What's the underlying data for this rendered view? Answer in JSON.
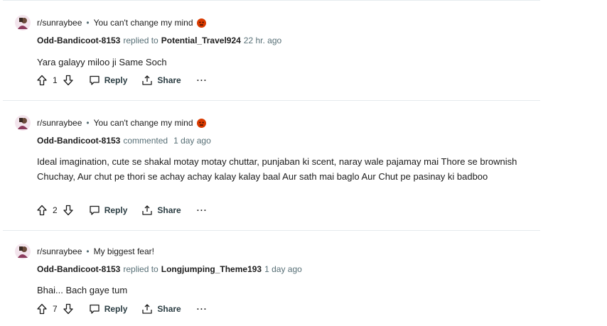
{
  "comments": [
    {
      "subreddit": "r/sunraybee",
      "separator": "•",
      "post_title": "You can't change my mind",
      "has_emoji": true,
      "username": "Odd-Bandicoot-8153",
      "action": "replied to",
      "target": "Potential_Travel924",
      "time": "22 hr. ago",
      "text": "Yara galayy miloo ji Same Soch",
      "votes": "1",
      "reply_label": "Reply",
      "share_label": "Share",
      "more_label": "···"
    },
    {
      "subreddit": "r/sunraybee",
      "separator": "•",
      "post_title": "You can't change my mind",
      "has_emoji": true,
      "username": "Odd-Bandicoot-8153",
      "action": "commented",
      "target": "",
      "time": "1 day ago",
      "text": "Ideal imagination, cute se shakal motay motay chuttar, punjaban ki scent, naray wale pajamay mai Thore se brownish Chuchay, Aur chut pe thori se achay achay kalay kalay baal Aur sath mai baglo Aur Chut pe pasinay ki badboo",
      "votes": "2",
      "reply_label": "Reply",
      "share_label": "Share",
      "more_label": "···"
    },
    {
      "subreddit": "r/sunraybee",
      "separator": "•",
      "post_title": "My biggest fear!",
      "has_emoji": false,
      "username": "Odd-Bandicoot-8153",
      "action": "replied to",
      "target": "Longjumping_Theme193",
      "time": "1 day ago",
      "text": "Bhai... Bach gaye tum",
      "votes": "7",
      "reply_label": "Reply",
      "share_label": "Share",
      "more_label": "···"
    }
  ],
  "colors": {
    "meta": "#576f76",
    "divider": "#e5ebee",
    "emoji": "#d93a00"
  }
}
